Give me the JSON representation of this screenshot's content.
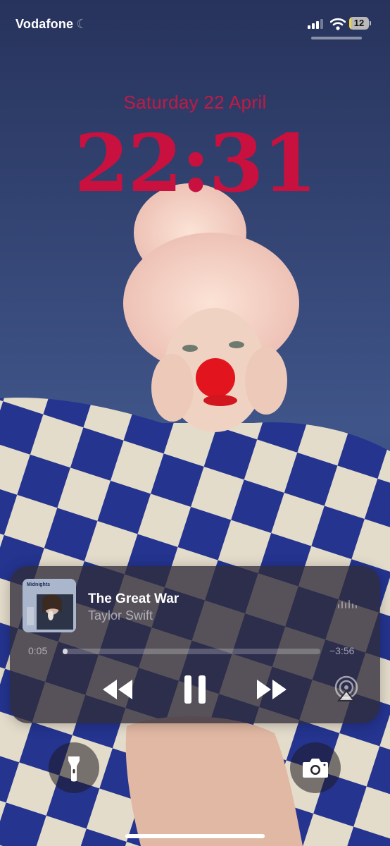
{
  "status_bar": {
    "carrier": "Vodafone",
    "battery_level": "12",
    "battery_fraction": 0.12,
    "signal_bars": 3,
    "icons": [
      "cellular-signal-icon",
      "wifi-icon",
      "battery-icon"
    ]
  },
  "lock_screen": {
    "date": "Saturday 22 April",
    "time": "22:31"
  },
  "now_playing": {
    "album_art_label": "Midnights",
    "title": "The Great War",
    "artist": "Taylor Swift",
    "elapsed": "0:05",
    "remaining": "−3:56",
    "progress_fraction": 0.02,
    "controls": [
      "previous-track-icon",
      "pause-icon",
      "next-track-icon",
      "airplay-icon"
    ]
  },
  "quick_actions": [
    "flashlight-icon",
    "camera-icon"
  ],
  "colors": {
    "clock": "#c8113f",
    "date": "#c21a45",
    "battery_fill": "#f3d23a"
  }
}
